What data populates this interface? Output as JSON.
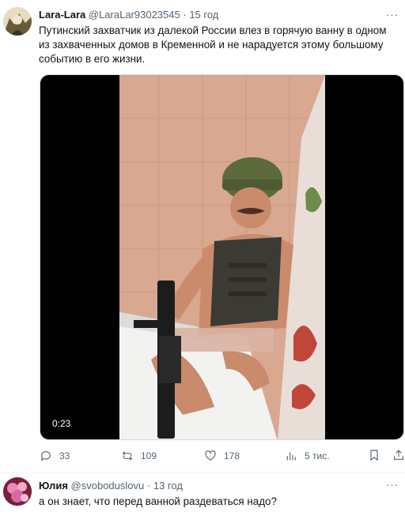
{
  "post": {
    "author_name": "Lara-Lara",
    "author_handle": "@LaraLar93023545",
    "separator": "·",
    "time": "15 год",
    "more": "···",
    "text": "Путинский захватчик из далекой России влез в горячую ванну в одном из захваченных домов в Кременной и не нарадуется этому большому событию в его жизни.",
    "video_duration": "0:23",
    "actions": {
      "replies": "33",
      "reposts": "109",
      "likes": "178",
      "views": "5 тис."
    },
    "avatar_icon": "portrait-avatar",
    "icons": [
      "reply-icon",
      "repost-icon",
      "like-icon",
      "views-icon",
      "bookmark-icon",
      "share-icon"
    ]
  },
  "reply": {
    "author_name": "Юлия",
    "author_handle": "@svoboduslovu",
    "separator": "·",
    "time": "13 год",
    "more": "···",
    "text": "а он знает, что перед ванной раздеваться надо?",
    "avatar_icon": "pink-flower-avatar"
  },
  "colors": {
    "text_primary": "#0f1419",
    "text_secondary": "#536471",
    "border": "#cfd9de"
  }
}
